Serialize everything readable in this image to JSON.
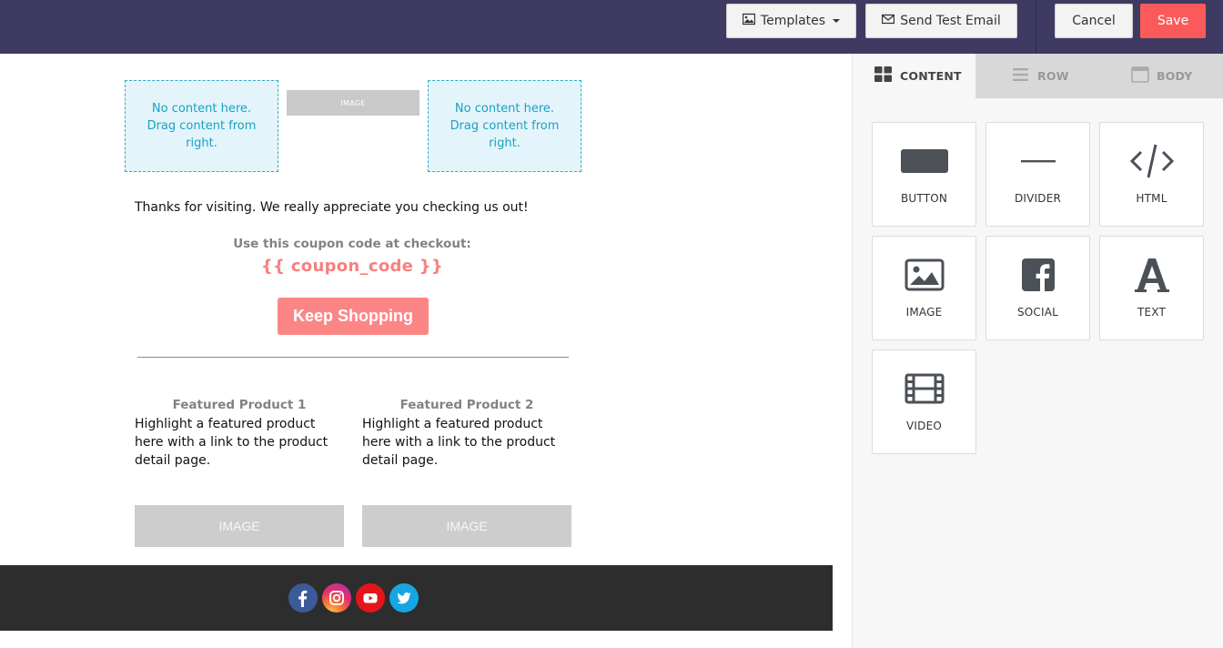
{
  "toolbar": {
    "templates_label": "Templates",
    "send_test_label": "Send Test Email",
    "cancel_label": "Cancel",
    "save_label": "Save",
    "background_color": "#3f3a61",
    "save_color": "#fa5a5a"
  },
  "email": {
    "dropzone_text": "No content here. Drag content from right.",
    "image_placeholder_small": "IMAGE",
    "thanks_text": "Thanks for visiting. We really appreciate you checking us out!",
    "coupon_label": "Use this coupon code at checkout:",
    "coupon_code": "{{ coupon_code }}",
    "cta_label": "Keep Shopping",
    "cta_color": "#fc8686",
    "products": [
      {
        "title": "Featured Product 1",
        "description": "Highlight a featured product here with a link to the product detail page.",
        "image_label": "IMAGE"
      },
      {
        "title": "Featured Product 2",
        "description": "Highlight a featured product here with a link to the product detail page.",
        "image_label": "IMAGE"
      }
    ],
    "footer_social_icons": [
      "facebook-icon",
      "instagram-icon",
      "youtube-icon",
      "twitter-icon"
    ]
  },
  "panel": {
    "tabs": [
      {
        "label": "CONTENT",
        "icon": "grid-icon",
        "active": true
      },
      {
        "label": "ROW",
        "icon": "rows-icon",
        "active": false
      },
      {
        "label": "BODY",
        "icon": "window-icon",
        "active": false
      }
    ],
    "tiles": [
      {
        "label": "BUTTON",
        "icon": "button-icon"
      },
      {
        "label": "DIVIDER",
        "icon": "divider-icon"
      },
      {
        "label": "HTML",
        "icon": "code-icon"
      },
      {
        "label": "IMAGE",
        "icon": "image-icon"
      },
      {
        "label": "SOCIAL",
        "icon": "facebook-icon"
      },
      {
        "label": "TEXT",
        "icon": "text-icon"
      },
      {
        "label": "VIDEO",
        "icon": "film-icon"
      }
    ]
  }
}
